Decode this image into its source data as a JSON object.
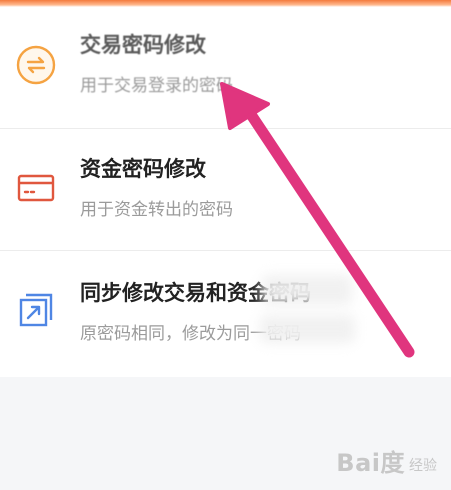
{
  "items": [
    {
      "title": "交易密码修改",
      "subtitle": "用于交易登录的密码",
      "icon": "exchange-arrows-icon"
    },
    {
      "title": "资金密码修改",
      "subtitle": "用于资金转出的密码",
      "icon": "card-icon"
    },
    {
      "title": "同步修改交易和资金密码",
      "subtitle": "原密码相同，修改为同一密码",
      "icon": "sync-arrow-icon"
    }
  ],
  "watermark": {
    "logo": "Bai度",
    "sub": "经验"
  },
  "colors": {
    "orange": "#f5a342",
    "red": "#e0573e",
    "blue": "#4f86e4",
    "arrow": "#e0357e"
  }
}
